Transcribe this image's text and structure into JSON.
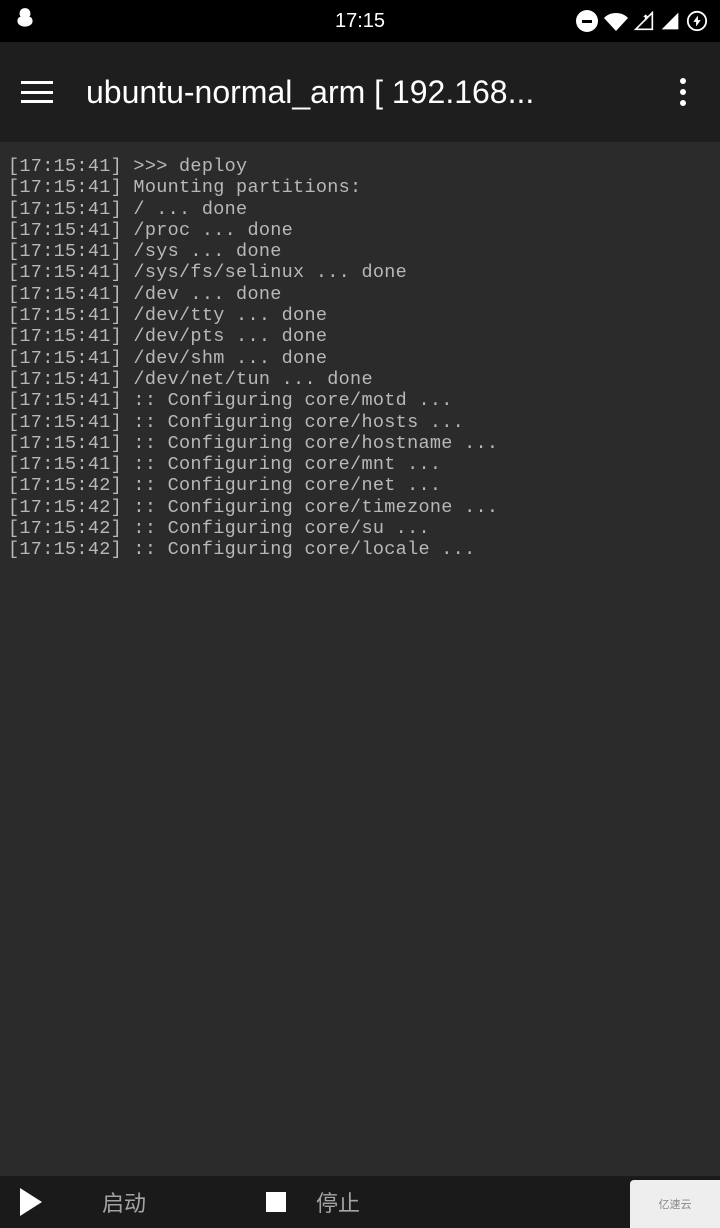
{
  "status": {
    "time": "17:15"
  },
  "appbar": {
    "title": "ubuntu-normal_arm  [ 192.168..."
  },
  "terminal": {
    "lines": [
      "[17:15:41] >>> deploy",
      "[17:15:41] Mounting partitions:",
      "[17:15:41] / ... done",
      "[17:15:41] /proc ... done",
      "[17:15:41] /sys ... done",
      "[17:15:41] /sys/fs/selinux ... done",
      "[17:15:41] /dev ... done",
      "[17:15:41] /dev/tty ... done",
      "[17:15:41] /dev/pts ... done",
      "[17:15:41] /dev/shm ... done",
      "[17:15:41] /dev/net/tun ... done",
      "[17:15:41] :: Configuring core/motd ...",
      "[17:15:41] :: Configuring core/hosts ...",
      "[17:15:41] :: Configuring core/hostname ...",
      "[17:15:41] :: Configuring core/mnt ...",
      "[17:15:42] :: Configuring core/net ...",
      "[17:15:42] :: Configuring core/timezone ...",
      "[17:15:42] :: Configuring core/su ...",
      "[17:15:42] :: Configuring core/locale ..."
    ]
  },
  "bottom": {
    "label1": "启动",
    "label2": "停止"
  },
  "watermark": "亿速云"
}
